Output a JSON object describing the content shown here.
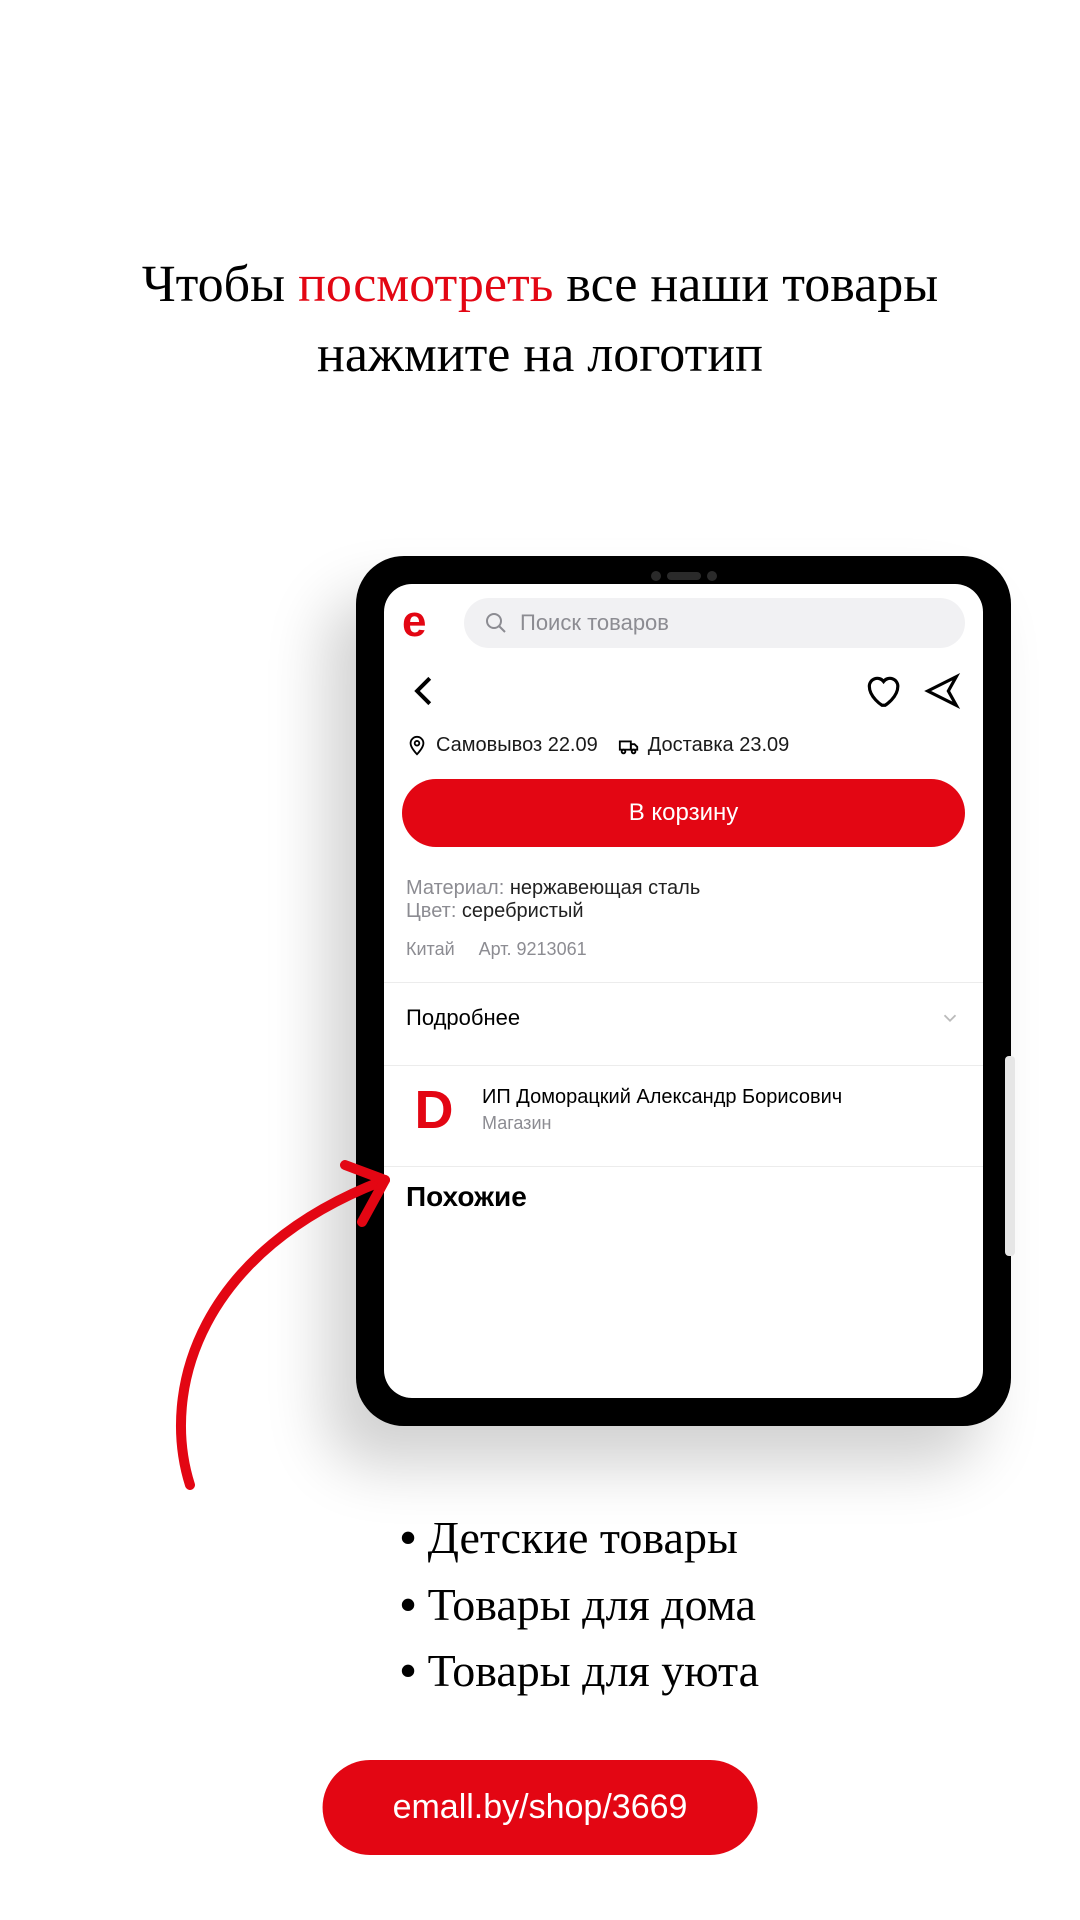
{
  "heading": {
    "p1": "Чтобы ",
    "hl": "посмотреть",
    "p2": " все наши товары",
    "p3": "нажмите на логотип"
  },
  "search": {
    "placeholder": "Поиск товаров"
  },
  "delivery": {
    "pickup": "Самовывоз 22.09",
    "ship": "Доставка 23.09"
  },
  "cart": "В корзину",
  "specs": {
    "materialKey": "Материал:",
    "materialVal": " нержавеющая сталь",
    "colorKey": "Цвет:",
    "colorVal": " серебристый",
    "country": "Китай",
    "art": "Арт. 9213061"
  },
  "more": "Подробнее",
  "seller": {
    "logo": "D",
    "name": "ИП Доморацкий Александр Борисович",
    "type": "Магазин"
  },
  "similar": "Похожие",
  "bullets": [
    "Детские товары",
    "Товары для дома",
    "Товары для уюта"
  ],
  "url": "emall.by/shop/3669",
  "logo_e": "e"
}
